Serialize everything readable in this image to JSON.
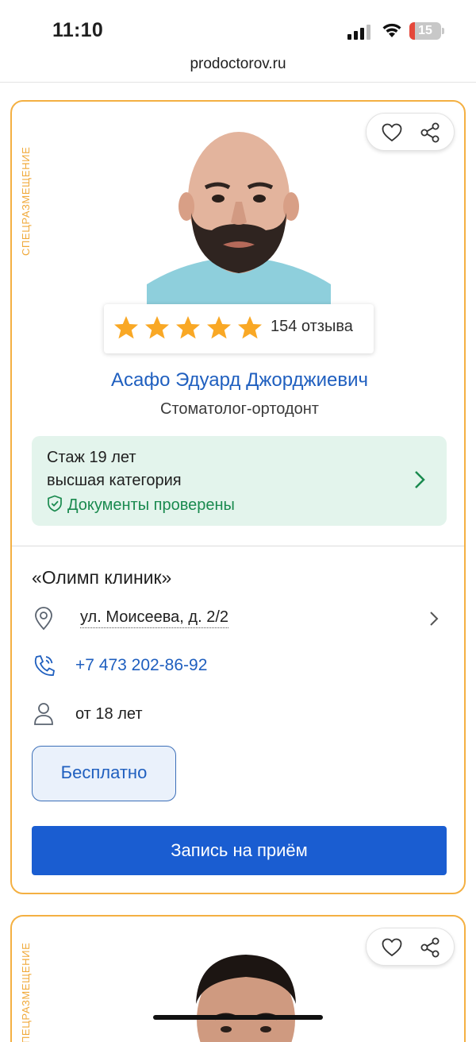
{
  "status_bar": {
    "time": "11:10",
    "battery_level": "15"
  },
  "browser": {
    "url": "prodoctorov.ru"
  },
  "cards": [
    {
      "side_label": "СПЕЦРАЗМЕЩЕНИЕ",
      "rating": {
        "stars": 5,
        "reviews": "154 отзыва"
      },
      "doctor": {
        "name": "Асафо Эдуард Джорджиевич",
        "specialty": "Стоматолог-ортодонт"
      },
      "info": {
        "experience": "Стаж 19 лет",
        "category": "высшая категория",
        "documents": "Документы проверены"
      },
      "clinic": {
        "name": "«Олимп клиник»",
        "address": "ул. Моисеева, д. 2/2",
        "phone": "+7 473 202-86-92",
        "age": "от 18 лет"
      },
      "badge": "Бесплатно",
      "book_button": "Запись на приём"
    },
    {
      "side_label": "СПЕЦРАЗМЕЩЕНИЕ"
    }
  ],
  "colors": {
    "accent_blue": "#1a5dd1",
    "border_orange": "#f4b042",
    "star": "#f9a825",
    "green": "#1a8a4f"
  }
}
